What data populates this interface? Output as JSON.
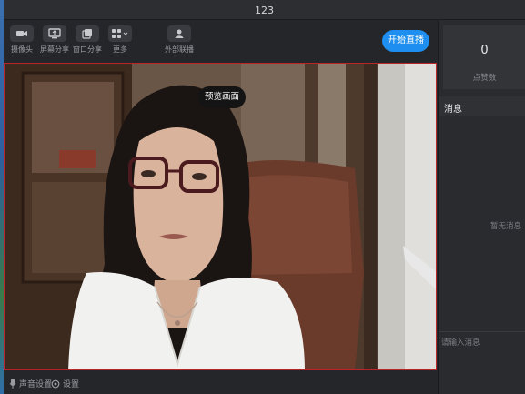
{
  "window": {
    "title": "123"
  },
  "toolbar": {
    "camera_label": "摄像头",
    "screen_share_label": "屏幕分享",
    "window_share_label": "窗口分享",
    "more_label": "更多",
    "external_link_label": "外部联播",
    "start_live_label": "开始直播"
  },
  "video": {
    "preview_label": "预览画面"
  },
  "bottom": {
    "audio_settings_label": "声音设置",
    "settings_label": "设置"
  },
  "sidebar": {
    "likes_count": "0",
    "likes_label": "点赞数",
    "messages_title": "消息",
    "empty_messages": "暂无消息",
    "input_placeholder": "请输入消息"
  },
  "colors": {
    "accent": "#1e8ef0",
    "video_border": "#b8262a",
    "background": "#25262a"
  }
}
